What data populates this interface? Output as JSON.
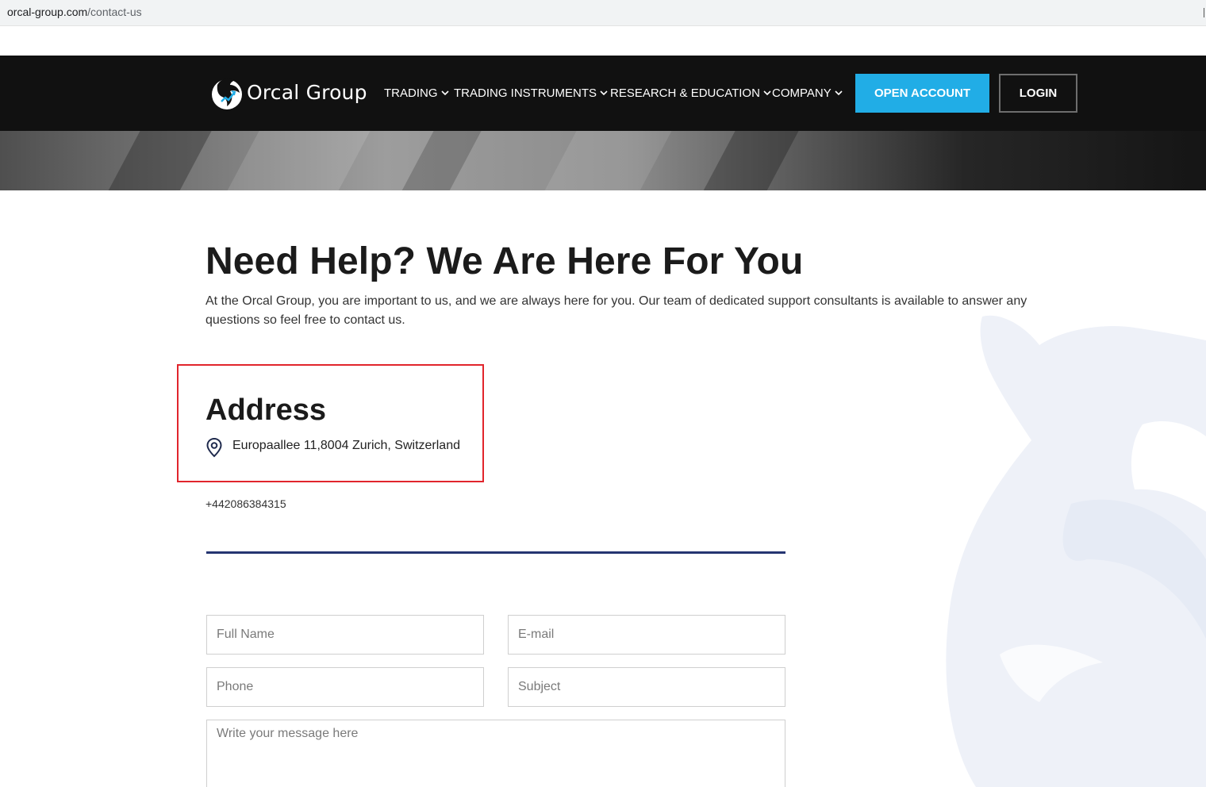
{
  "browser": {
    "url_domain": "orcal-group.com",
    "url_path": "/contact-us"
  },
  "header": {
    "brand_name": "Orcal Group",
    "menu": [
      {
        "label": "TRADING"
      },
      {
        "label": "TRADING INSTRUMENTS"
      },
      {
        "label": "RESEARCH & EDUCATION"
      },
      {
        "label": "COMPANY"
      }
    ],
    "open_account_label": "OPEN ACCOUNT",
    "login_label": "LOGIN"
  },
  "main": {
    "title": "Need Help? We Are Here For You",
    "intro": "At the Orcal Group, you are important to us, and we are always here for you. Our team of dedicated support consultants is available to answer any questions so feel free to contact us.",
    "address_heading": "Address",
    "address": "Europaallee 11,8004 Zurich, Switzerland",
    "phone": "+442086384315"
  },
  "form": {
    "full_name_placeholder": "Full Name",
    "email_placeholder": "E-mail",
    "phone_placeholder": "Phone",
    "subject_placeholder": "Subject",
    "message_placeholder": "Write your message here"
  },
  "colors": {
    "nav_background": "#111111",
    "accent": "#21ade6",
    "highlight_border": "#e1252c",
    "divider": "#253571"
  },
  "icons": [
    "orca-logo-icon",
    "chevron-down-icon",
    "location-pin-icon",
    "orca-watermark"
  ]
}
